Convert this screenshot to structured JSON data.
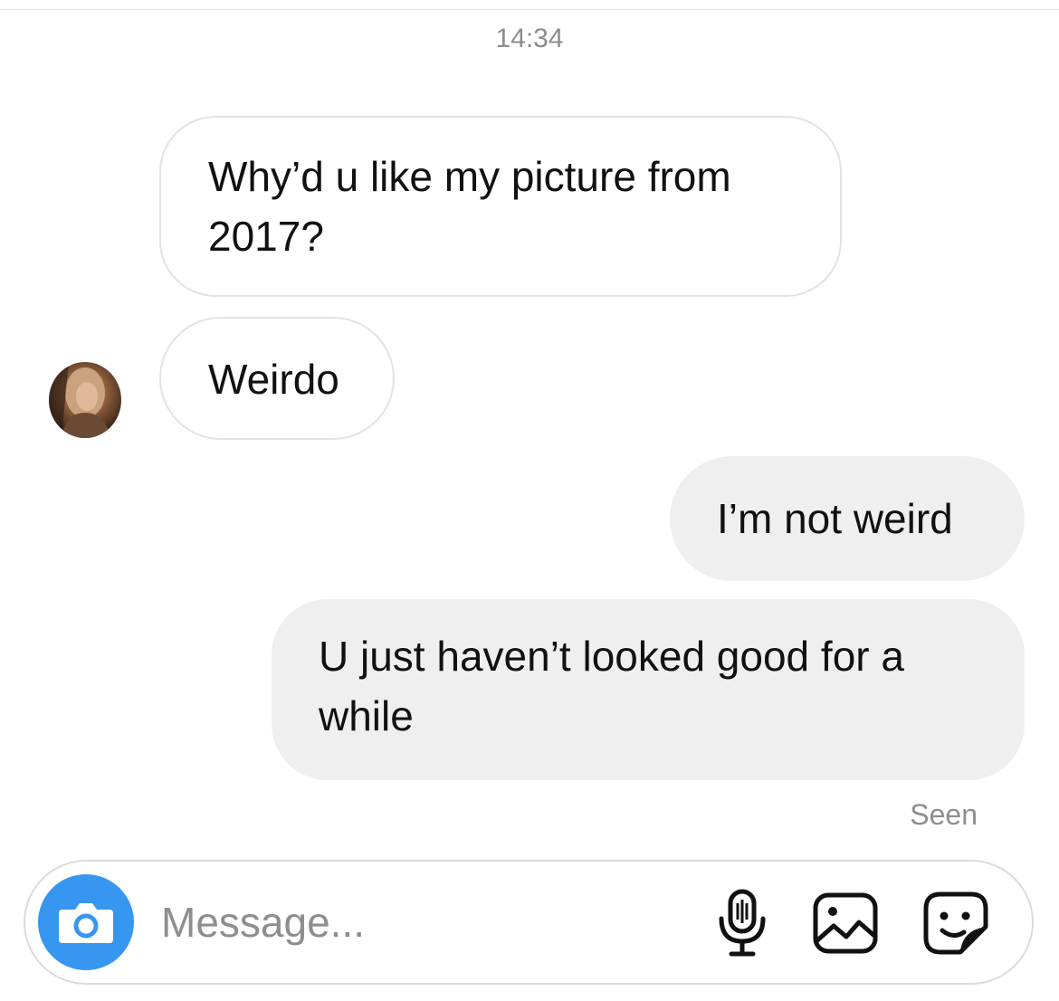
{
  "conversation": {
    "timestamp": "14:34",
    "messages": [
      {
        "direction": "incoming",
        "text": "Why’d u like my picture from 2017?"
      },
      {
        "direction": "incoming",
        "text": "Weirdo"
      },
      {
        "direction": "outgoing",
        "text": "I’m not weird"
      },
      {
        "direction": "outgoing",
        "text": "U just haven’t looked good for a while"
      }
    ],
    "seen_label": "Seen"
  },
  "composer": {
    "placeholder": "Message...",
    "icons": [
      "camera-icon",
      "microphone-icon",
      "gallery-icon",
      "sticker-icon"
    ]
  },
  "colors": {
    "accent": "#3797f0",
    "outgoing_bubble": "#efefef",
    "muted_text": "#8e8e8e"
  }
}
